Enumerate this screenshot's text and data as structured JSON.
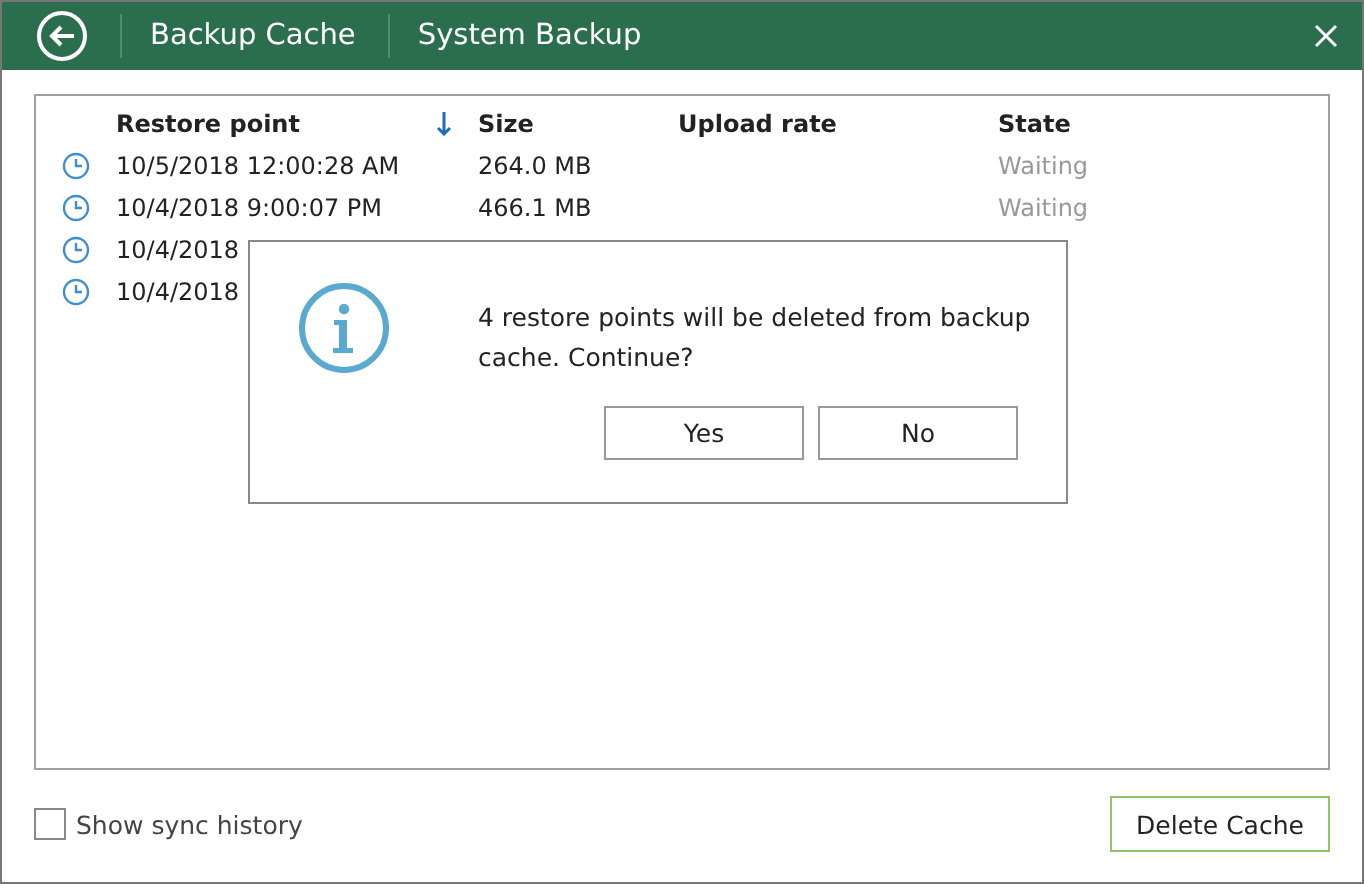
{
  "window": {
    "title_tabs": [
      "Backup Cache",
      "System Backup"
    ]
  },
  "table": {
    "columns": [
      "Restore point",
      "Size",
      "Upload rate",
      "State"
    ],
    "rows": [
      {
        "cells": [
          "10/5/2018 12:00:28 AM",
          "264.0 MB",
          "",
          "Waiting"
        ]
      },
      {
        "cells": [
          "10/4/2018 9:00:07 PM",
          "466.1 MB",
          "",
          "Waiting"
        ]
      },
      {
        "cells": [
          "10/4/2018",
          "",
          "",
          ""
        ]
      },
      {
        "cells": [
          "10/4/2018",
          "",
          "",
          ""
        ]
      }
    ]
  },
  "dialog": {
    "message": "4 restore points will be deleted from backup cache. Continue?",
    "buttons": [
      "Yes",
      "No"
    ]
  },
  "show_sync_history": {
    "label": "Show sync history",
    "checked": false
  },
  "delete_button": "Delete Cache"
}
